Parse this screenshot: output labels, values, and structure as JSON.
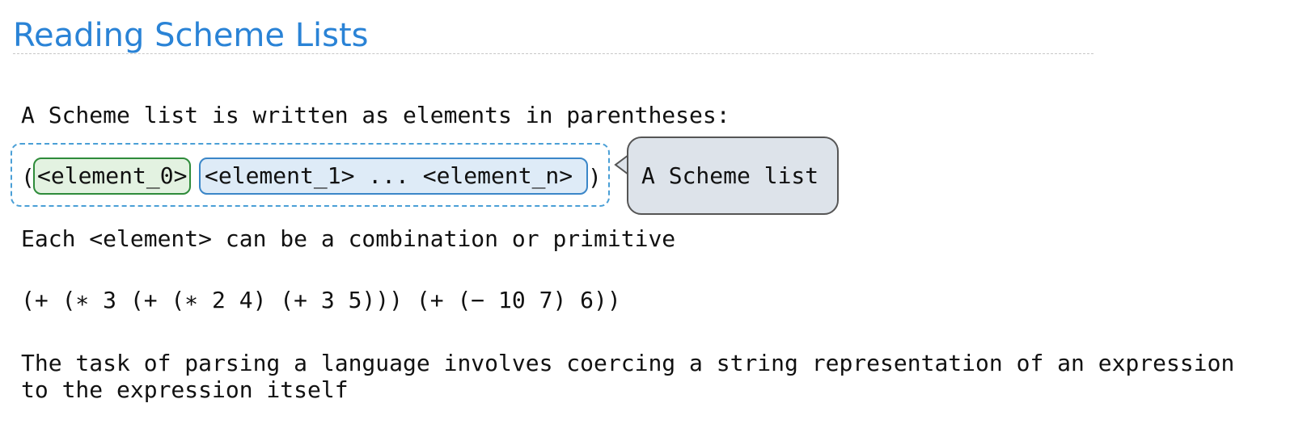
{
  "page": {
    "title": "Reading Scheme Lists",
    "intro": "A Scheme list is written as elements in parentheses:",
    "diagram": {
      "open_paren": "(",
      "element_first": "<element_0>",
      "element_rest": "<element_1> ... <element_n>",
      "close_paren": ")",
      "callout": "A Scheme list"
    },
    "element_note": "Each <element> can be a combination or primitive",
    "example_expression": "(+ (∗ 3 (+ (∗ 2 4) (+ 3 5))) (+ (− 10 7) 6))",
    "task_line_1": "The task of parsing a language involves coercing a string representation of an expression",
    "task_line_2": "to the expression itself"
  },
  "colors": {
    "title": "#2a83d6",
    "first_element_border": "#2e8b3a",
    "first_element_fill": "#e3f2e1",
    "rest_elements_border": "#3a86c8",
    "rest_elements_fill": "#deebf7",
    "list_outline": "#4a9fd6",
    "callout_fill": "#dde3ea"
  }
}
